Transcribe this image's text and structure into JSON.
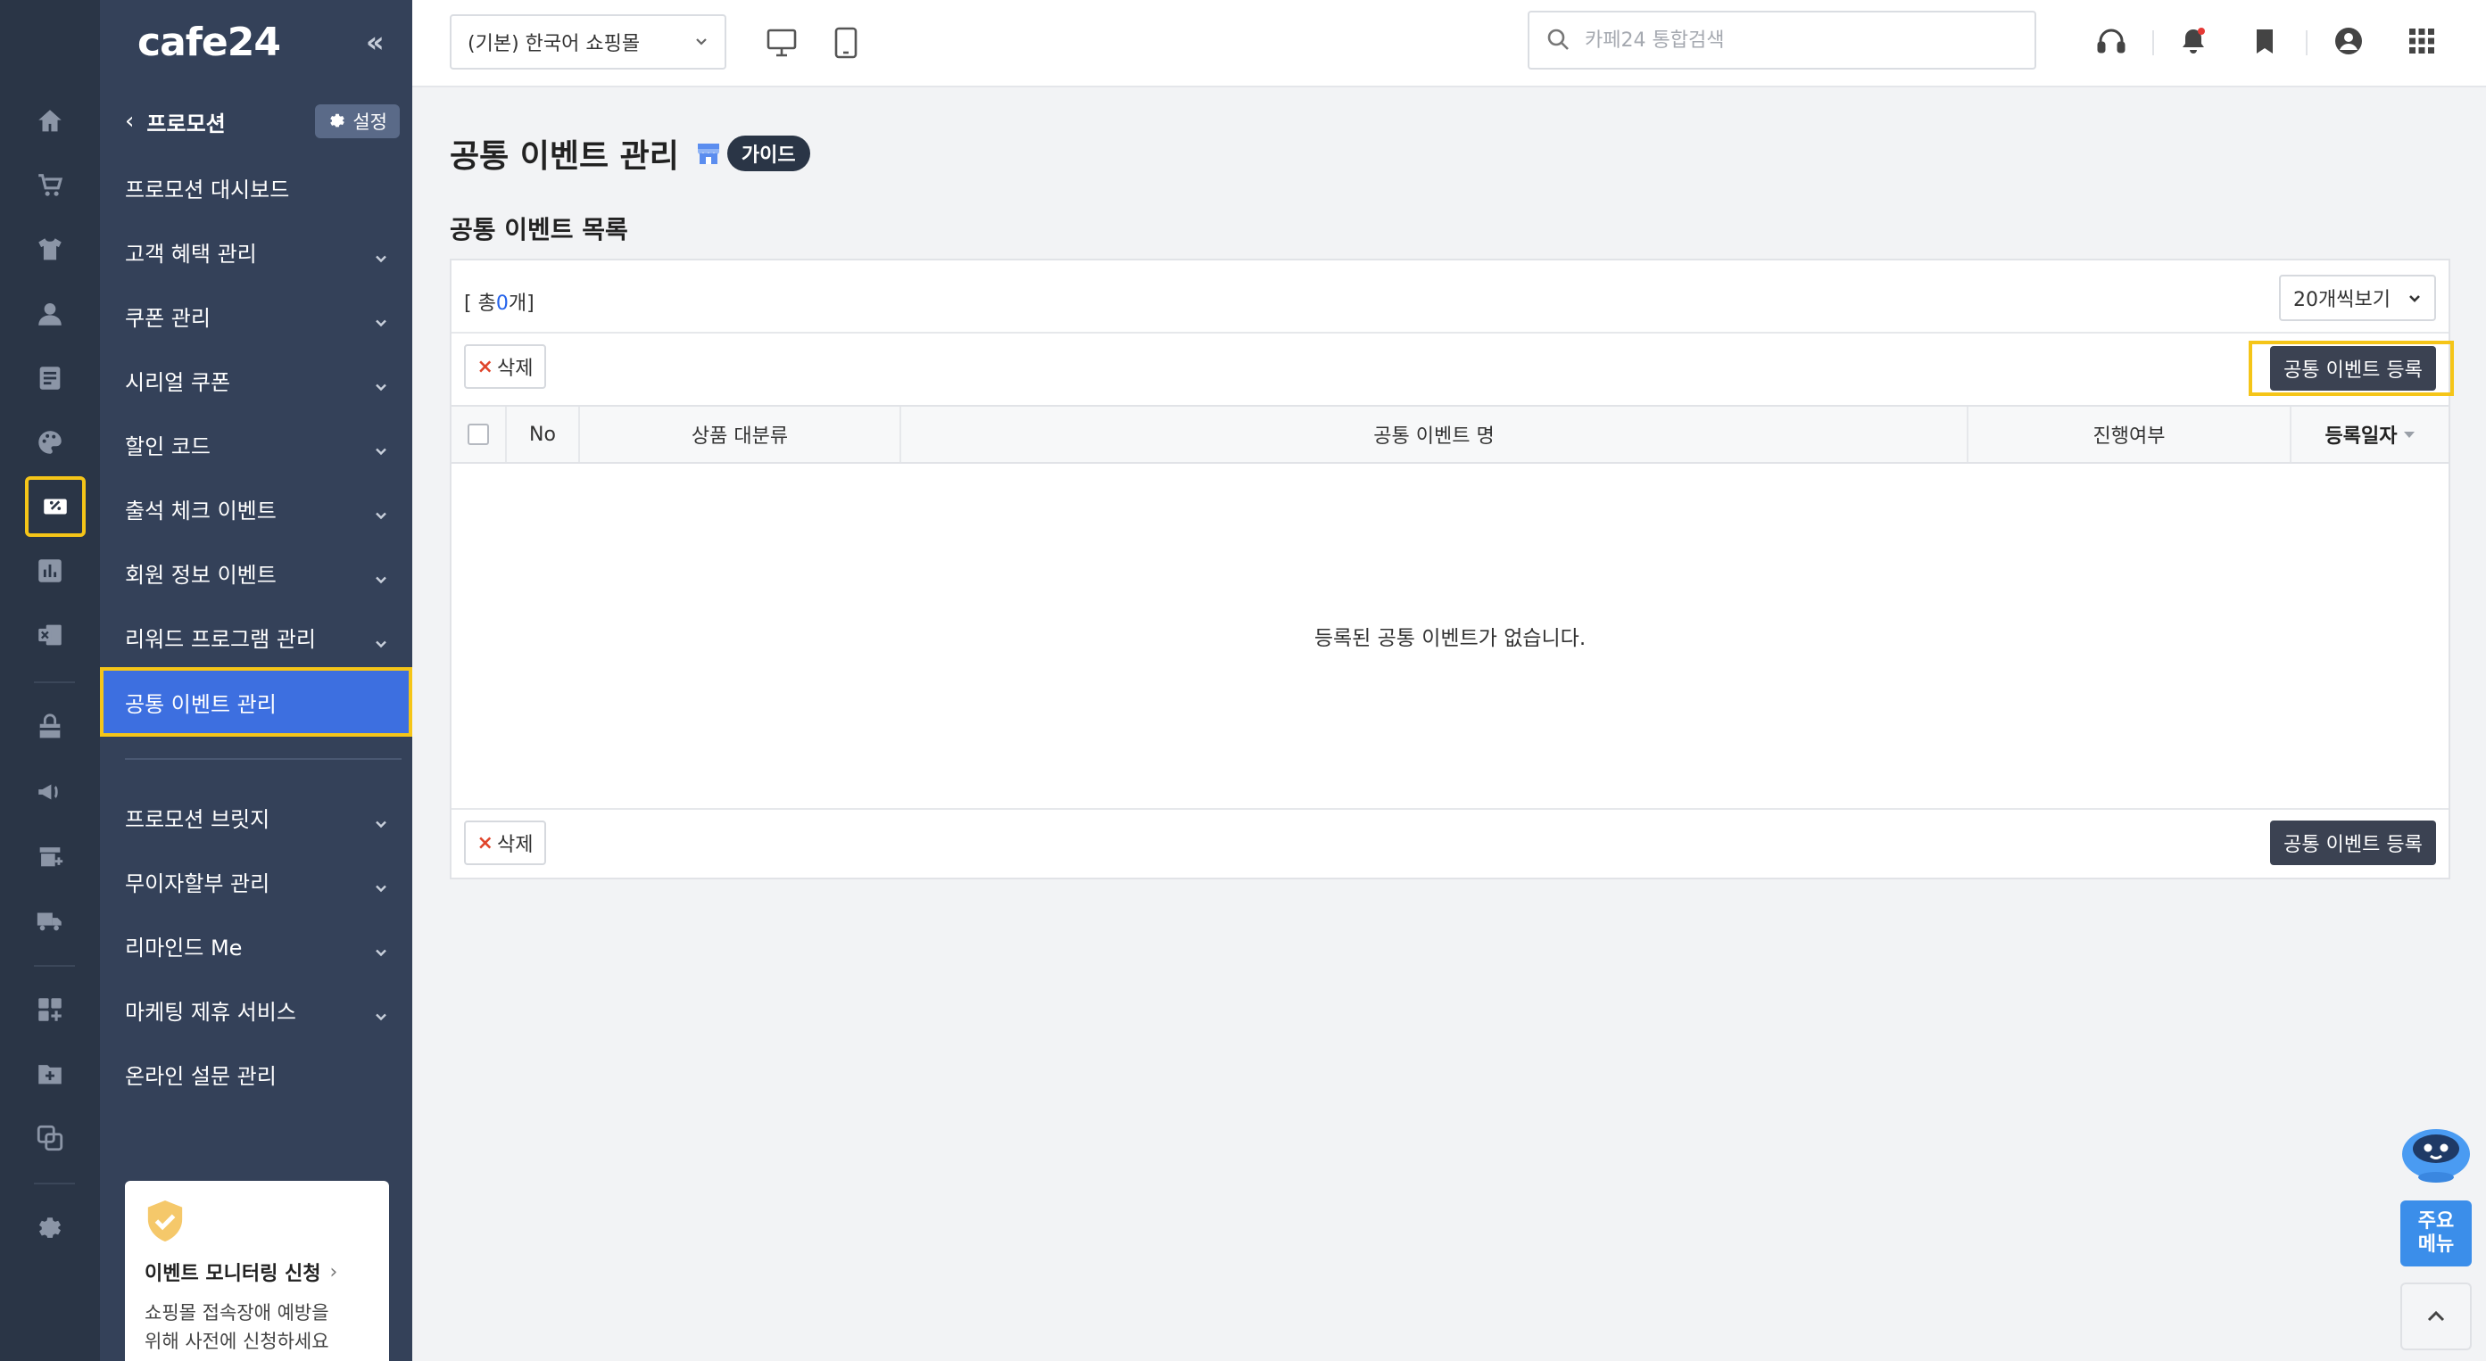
{
  "brand": {
    "logo": "cafe24",
    "collapse_icon": "«"
  },
  "colors": {
    "rail_bg": "#2a3546",
    "panel_bg": "#344159",
    "active_bg": "#3d6fe0",
    "highlight": "#f5c518",
    "dark_btn": "#3b4252",
    "accent_blue": "#3b8eea"
  },
  "rail": {
    "items": [
      {
        "icon": "home-icon"
      },
      {
        "icon": "cart-icon"
      },
      {
        "icon": "shirt-icon"
      },
      {
        "icon": "user-icon"
      },
      {
        "icon": "board-icon"
      },
      {
        "icon": "palette-icon"
      },
      {
        "icon": "promotion-icon",
        "active": true
      },
      {
        "icon": "stats-icon"
      },
      {
        "icon": "excel-icon"
      },
      {
        "icon": "store-icon"
      },
      {
        "icon": "megaphone-icon"
      },
      {
        "icon": "shop-plus-icon"
      },
      {
        "icon": "truck-icon"
      },
      {
        "icon": "apps-plus-icon"
      },
      {
        "icon": "folder-plus-icon"
      },
      {
        "icon": "copy-icon"
      },
      {
        "icon": "gear-icon"
      }
    ]
  },
  "panel": {
    "back_icon": "‹",
    "title": "프로모션",
    "settings_label": "설정",
    "menu": [
      {
        "label": "프로모션 대시보드",
        "expandable": false
      },
      {
        "label": "고객 혜택 관리",
        "expandable": true
      },
      {
        "label": "쿠폰 관리",
        "expandable": true
      },
      {
        "label": "시리얼 쿠폰",
        "expandable": true
      },
      {
        "label": "할인 코드",
        "expandable": true
      },
      {
        "label": "출석 체크 이벤트",
        "expandable": true
      },
      {
        "label": "회원 정보 이벤트",
        "expandable": true
      },
      {
        "label": "리워드 프로그램 관리",
        "expandable": true
      },
      {
        "label": "공통 이벤트 관리",
        "expandable": false,
        "active": true
      }
    ],
    "menu2": [
      {
        "label": "프로모션 브릿지",
        "expandable": true
      },
      {
        "label": "무이자할부 관리",
        "expandable": true
      },
      {
        "label": "리마인드 Me",
        "expandable": true
      },
      {
        "label": "마케팅 제휴 서비스",
        "expandable": true
      },
      {
        "label": "온라인 설문 관리",
        "expandable": false
      }
    ],
    "promo_card": {
      "title": "이벤트 모니터링 신청",
      "arrow": "›",
      "desc_line1": "쇼핑몰 접속장애 예방을",
      "desc_line2": "위해 사전에 신청하세요"
    }
  },
  "topbar": {
    "shop_select": "(기본) 한국어 쇼핑몰",
    "search_placeholder": "카페24 통합검색"
  },
  "content": {
    "page_title": "공통 이벤트 관리",
    "guide_label": "가이드",
    "section_title": "공통 이벤트 목록",
    "total_prefix": "[ 총",
    "total_count": "0",
    "total_suffix": "개]",
    "per_page": "20개씩보기",
    "delete_label": "삭제",
    "register_label": "공통 이벤트 등록",
    "columns": [
      "No",
      "상품 대분류",
      "공통 이벤트 명",
      "진행여부",
      "등록일자"
    ],
    "empty_message": "등록된 공통 이벤트가 없습니다."
  },
  "floating": {
    "main_menu_line1": "주요",
    "main_menu_line2": "메뉴"
  }
}
